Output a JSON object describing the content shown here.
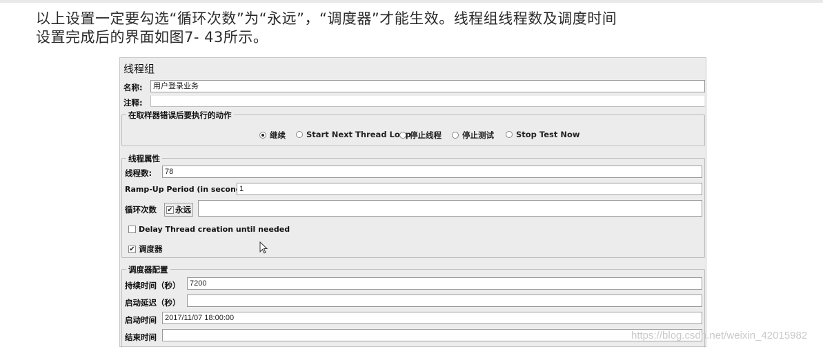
{
  "caption": {
    "line1": "以上设置一定要勾选“循环次数”为“永远”，“调度器”才能生效。线程组线程数及调度时间",
    "line2": "设置完成后的界面如图7- 43所示。"
  },
  "panel": {
    "title": "线程组",
    "name_label": "名称:",
    "name_value": "用户登录业务",
    "comment_label": "注释:",
    "comment_value": "",
    "error_group": {
      "legend": "在取样器错误后要执行的动作",
      "options": [
        "继续",
        "Start Next Thread Loop",
        "停止线程",
        "停止测试",
        "Stop Test Now"
      ],
      "selected": "继续"
    },
    "thread_props": {
      "legend": "线程属性",
      "threads_label": "线程数:",
      "threads_value": "78",
      "rampup_label": "Ramp-Up Period (in seconds):",
      "rampup_value": "1",
      "loop_label": "循环次数",
      "forever_label": "永远",
      "forever_checked": true,
      "loop_value": "",
      "delay_label": "Delay Thread creation until needed",
      "delay_checked": false,
      "scheduler_label": "调度器",
      "scheduler_checked": true
    },
    "scheduler_config": {
      "legend": "调度器配置",
      "duration_label": "持续时间（秒）",
      "duration_value": "7200",
      "startup_delay_label": "启动延迟（秒）",
      "startup_delay_value": "",
      "start_time_label": "启动时间",
      "start_time_value": "2017/11/07 18:00:00",
      "end_time_label": "结束时间",
      "end_time_value": ""
    }
  },
  "watermark": "https://blog.csdn.net/weixin_42015982",
  "icons": {
    "cursor": "mouse-pointer-icon",
    "check": "checkmark-icon"
  },
  "colors": {
    "panel_bg": "#ececec",
    "border": "#bdbdbd",
    "field_bg": "#ffffff"
  }
}
